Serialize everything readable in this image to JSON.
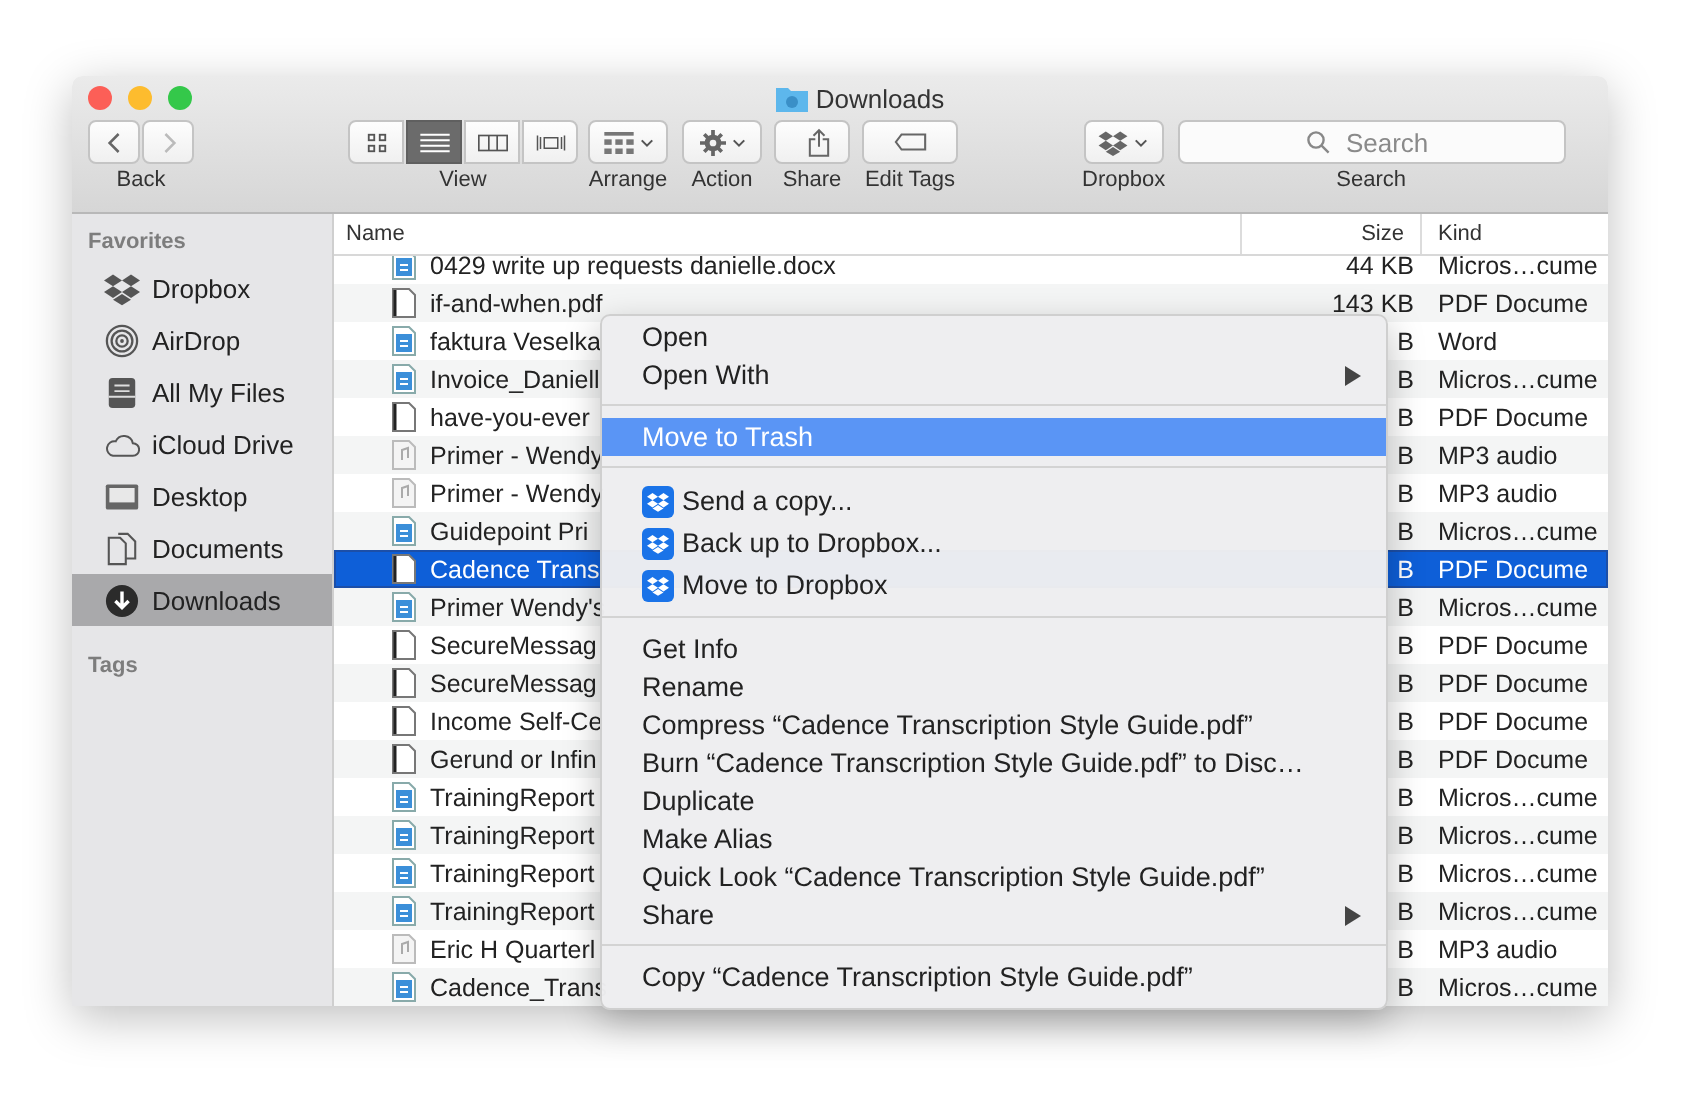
{
  "window": {
    "title": "Downloads"
  },
  "toolbar": [
    {
      "kind": "nav",
      "label": "Back"
    },
    {
      "kind": "view",
      "label": "View",
      "segments": [
        {
          "kind": "icons",
          "selected": false
        },
        {
          "kind": "list",
          "selected": true
        },
        {
          "kind": "columns",
          "selected": false
        },
        {
          "kind": "cover",
          "selected": false
        }
      ]
    },
    {
      "kind": "arrange",
      "label": "Arrange"
    },
    {
      "kind": "action",
      "label": "Action"
    },
    {
      "kind": "share",
      "label": "Share"
    },
    {
      "kind": "tags",
      "label": "Edit Tags"
    },
    {
      "kind": "dropbox",
      "label": "Dropbox"
    },
    {
      "kind": "search",
      "label": "Search",
      "placeholder": "Search"
    }
  ],
  "sidebar": {
    "sections": [
      {
        "title": "Favorites",
        "items": [
          {
            "kind": "dropbox",
            "label": "Dropbox",
            "selected": false
          },
          {
            "kind": "airdrop",
            "label": "AirDrop",
            "selected": false
          },
          {
            "kind": "files",
            "label": "All My Files",
            "selected": false
          },
          {
            "kind": "cloud",
            "label": "iCloud Drive",
            "selected": false
          },
          {
            "kind": "desktop",
            "label": "Desktop",
            "selected": false
          },
          {
            "kind": "documents",
            "label": "Documents",
            "selected": false
          },
          {
            "kind": "downloads",
            "label": "Downloads",
            "selected": true
          }
        ]
      },
      {
        "title": "Tags"
      }
    ]
  },
  "table": {
    "columns": [
      "Name",
      "Size",
      "Kind"
    ],
    "rows": [
      {
        "kind": "doc",
        "name": "0429 write up requests danielle.docx",
        "size": "44 KB",
        "type_label": "Micros…cume",
        "selected": false
      },
      {
        "kind": "pdf",
        "name": "if-and-when.pdf",
        "size": "143 KB",
        "type_label": "PDF Docume",
        "selected": false
      },
      {
        "kind": "doc",
        "name": "faktura Veselka",
        "size": "B",
        "type_label": "Word",
        "selected": false
      },
      {
        "kind": "doc",
        "name": "Invoice_Daniell",
        "size": "B",
        "type_label": "Micros…cume",
        "selected": false
      },
      {
        "kind": "pdf",
        "name": "have-you-ever",
        "size": "B",
        "type_label": "PDF Docume",
        "selected": false
      },
      {
        "kind": "audio",
        "name": "Primer - Wendy",
        "size": "B",
        "type_label": "MP3 audio",
        "selected": false
      },
      {
        "kind": "audio",
        "name": "Primer - Wendy",
        "size": "B",
        "type_label": "MP3 audio",
        "selected": false
      },
      {
        "kind": "doc",
        "name": "Guidepoint Pri",
        "size": "B",
        "type_label": "Micros…cume",
        "selected": false
      },
      {
        "kind": "pdf",
        "name": "Cadence Trans",
        "size": "B",
        "type_label": "PDF Docume",
        "selected": true
      },
      {
        "kind": "doc",
        "name": "Primer Wendy's",
        "size": "B",
        "type_label": "Micros…cume",
        "selected": false
      },
      {
        "kind": "pdf",
        "name": "SecureMessag",
        "size": "B",
        "type_label": "PDF Docume",
        "selected": false
      },
      {
        "kind": "pdf",
        "name": "SecureMessag",
        "size": "B",
        "type_label": "PDF Docume",
        "selected": false
      },
      {
        "kind": "pdf",
        "name": "Income Self-Ce",
        "size": "B",
        "type_label": "PDF Docume",
        "selected": false
      },
      {
        "kind": "pdf",
        "name": "Gerund or Infin",
        "size": "B",
        "type_label": "PDF Docume",
        "selected": false
      },
      {
        "kind": "doc",
        "name": "TrainingReport",
        "size": "B",
        "type_label": "Micros…cume",
        "selected": false
      },
      {
        "kind": "doc",
        "name": "TrainingReport",
        "size": "B",
        "type_label": "Micros…cume",
        "selected": false
      },
      {
        "kind": "doc",
        "name": "TrainingReport",
        "size": "B",
        "type_label": "Micros…cume",
        "selected": false
      },
      {
        "kind": "doc",
        "name": "TrainingReport",
        "size": "B",
        "type_label": "Micros…cume",
        "selected": false
      },
      {
        "kind": "audio",
        "name": "Eric H Quarterl",
        "size": "B",
        "type_label": "MP3 audio",
        "selected": false
      },
      {
        "kind": "doc",
        "name": "Cadence_Trans",
        "size": "B",
        "type_label": "Micros…cume",
        "selected": false
      }
    ]
  },
  "context_menu": {
    "groups": [
      [
        {
          "kind": "plain",
          "label": "Open",
          "selected": false,
          "submenu": false
        },
        {
          "kind": "plain",
          "label": "Open With",
          "selected": false,
          "submenu": true
        }
      ],
      [
        {
          "kind": "plain",
          "label": "Move to Trash",
          "selected": true,
          "submenu": false
        }
      ],
      [
        {
          "kind": "dropbox",
          "label": "Send a copy...",
          "selected": false,
          "submenu": false
        },
        {
          "kind": "dropbox",
          "label": "Back up to Dropbox...",
          "selected": false,
          "submenu": false
        },
        {
          "kind": "dropbox",
          "label": "Move to Dropbox",
          "selected": false,
          "submenu": false
        }
      ],
      [
        {
          "kind": "plain",
          "label": "Get Info",
          "selected": false,
          "submenu": false
        },
        {
          "kind": "plain",
          "label": "Rename",
          "selected": false,
          "submenu": false
        },
        {
          "kind": "plain",
          "label": "Compress “Cadence Transcription Style Guide.pdf”",
          "selected": false,
          "submenu": false
        },
        {
          "kind": "plain",
          "label": "Burn “Cadence Transcription Style Guide.pdf” to Disc…",
          "selected": false,
          "submenu": false
        },
        {
          "kind": "plain",
          "label": "Duplicate",
          "selected": false,
          "submenu": false
        },
        {
          "kind": "plain",
          "label": "Make Alias",
          "selected": false,
          "submenu": false
        },
        {
          "kind": "plain",
          "label": "Quick Look “Cadence Transcription Style Guide.pdf”",
          "selected": false,
          "submenu": false
        },
        {
          "kind": "plain",
          "label": "Share",
          "selected": false,
          "submenu": true
        }
      ],
      [
        {
          "kind": "plain",
          "label": "Copy “Cadence Transcription Style Guide.pdf”",
          "selected": false,
          "submenu": false
        }
      ]
    ]
  }
}
